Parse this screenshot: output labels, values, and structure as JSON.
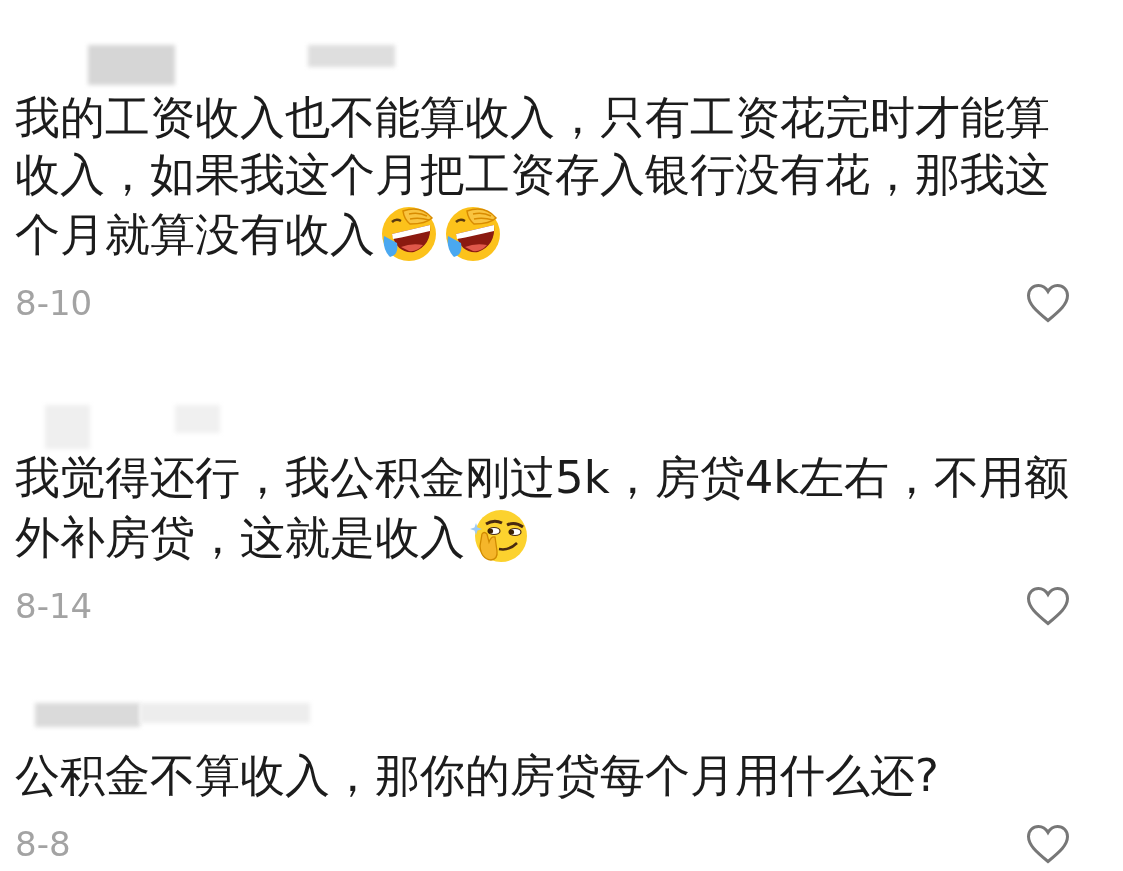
{
  "comments": [
    {
      "author_blurred": true,
      "text": "我的工资收入也不能算收入，只有工资花完时才能算收入，如果我这个月把工资存入银行没有花，那我这个月就算没有收入",
      "emojis": [
        {
          "kind": "laughing"
        },
        {
          "kind": "laughing"
        }
      ],
      "date": "8-10",
      "liked": false
    },
    {
      "author_blurred": true,
      "text": "我觉得还行，我公积金刚过5k，房贷4k左右，不用额外补房贷，这就是收入",
      "emojis": [
        {
          "kind": "smirking"
        }
      ],
      "date": "8-14",
      "liked": false
    },
    {
      "author_blurred": true,
      "text": "公积金不算收入，那你的房贷每个月用什么还?",
      "date": "8-8",
      "liked": false
    }
  ]
}
